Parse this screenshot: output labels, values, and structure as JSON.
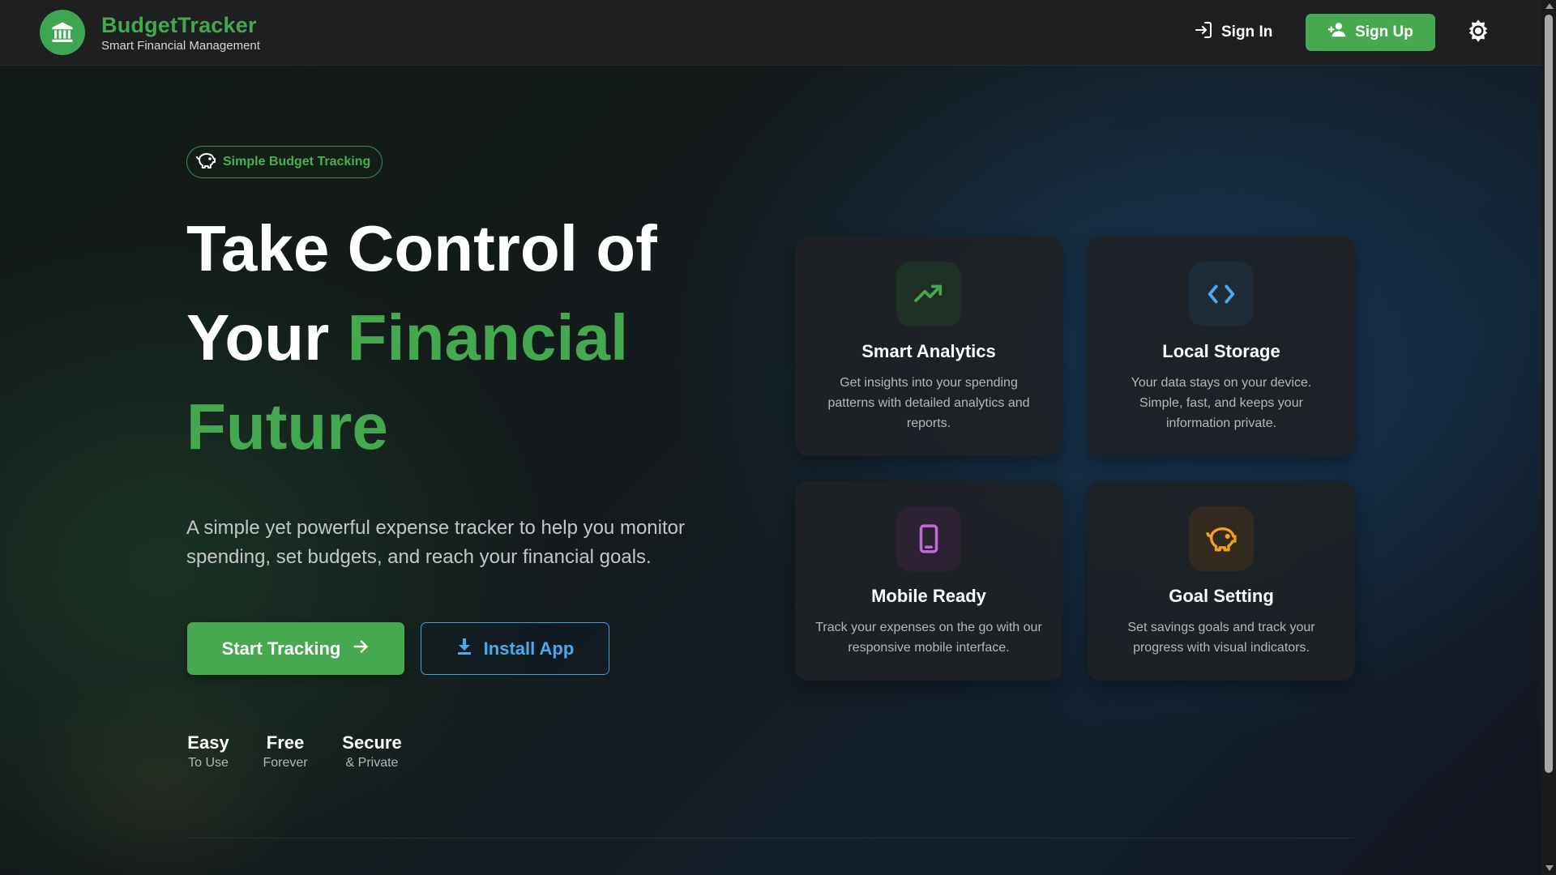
{
  "header": {
    "brand_name": "BudgetTracker",
    "brand_tagline": "Smart Financial Management",
    "sign_in_label": "Sign In",
    "sign_up_label": "Sign Up"
  },
  "hero": {
    "badge_label": "Simple Budget Tracking",
    "title_line1": "Take Control of",
    "title_line2_plain": "Your ",
    "title_line2_accent": "Financial",
    "title_line3_accent": "Future",
    "description": "A simple yet powerful expense tracker to help you monitor spending, set budgets, and reach your financial goals.",
    "start_button_label": "Start Tracking",
    "install_button_label": "Install App",
    "stats": [
      {
        "title": "Easy",
        "subtitle": "To Use"
      },
      {
        "title": "Free",
        "subtitle": "Forever"
      },
      {
        "title": "Secure",
        "subtitle": "& Private"
      }
    ]
  },
  "features": [
    {
      "title": "Smart Analytics",
      "description": "Get insights into your spending patterns with detailed analytics and reports.",
      "icon": "trending-up-icon",
      "color": "#43a84e"
    },
    {
      "title": "Local Storage",
      "description": "Your data stays on your device. Simple, fast, and keeps your information private.",
      "icon": "code-icon",
      "color": "#4aa9ef"
    },
    {
      "title": "Mobile Ready",
      "description": "Track your expenses on the go with our responsive mobile interface.",
      "icon": "smartphone-icon",
      "color": "#c36ad8"
    },
    {
      "title": "Goal Setting",
      "description": "Set savings goals and track your progress with visual indicators.",
      "icon": "piggy-bank-icon",
      "color": "#f0a020"
    }
  ],
  "colors": {
    "accent_green": "#43a84e",
    "accent_blue": "#4aa9ef",
    "header_bg": "#1d1f21"
  }
}
